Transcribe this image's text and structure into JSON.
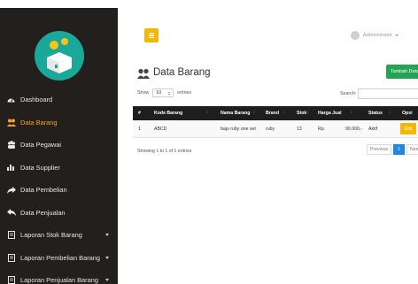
{
  "colors": {
    "sidebar_bg": "#231f1c",
    "active_menu": "#f5a623",
    "accent_yellow": "#f5b800",
    "add_button": "#23a455",
    "table_header": "#1e1e1e",
    "pagination_active": "#1e88e5",
    "logo_circle": "#1aa89a"
  },
  "sidebar": {
    "logo_icon": "box-with-coins-icon",
    "items": [
      {
        "label": "Dashboard",
        "icon": "gauge-icon",
        "active": false,
        "has_caret": false
      },
      {
        "label": "Data Barang",
        "icon": "people-icon",
        "active": true,
        "has_caret": false
      },
      {
        "label": "Data Pegawai",
        "icon": "users-icon",
        "active": false,
        "has_caret": false
      },
      {
        "label": "Data Supplier",
        "icon": "bar-chart-icon",
        "active": false,
        "has_caret": false
      },
      {
        "label": "Data Pembelian",
        "icon": "share-icon",
        "active": false,
        "has_caret": false
      },
      {
        "label": "Data Penjualan",
        "icon": "reply-icon",
        "active": false,
        "has_caret": false
      },
      {
        "label": "Laporan Stok Barang",
        "icon": "document-icon",
        "active": false,
        "has_caret": true
      },
      {
        "label": "Laporan Pembelian Barang",
        "icon": "document-icon",
        "active": false,
        "has_caret": true
      },
      {
        "label": "Laporan Penjualan Barang",
        "icon": "document-icon",
        "active": false,
        "has_caret": true
      }
    ]
  },
  "header": {
    "menu_toggle_icon": "hamburger-icon",
    "user_name": "Administrator"
  },
  "page": {
    "title": "Data Barang",
    "add_button_label": "Tambah Data"
  },
  "table_controls": {
    "show_label": "Show",
    "page_length": "10",
    "entries_label": "entries",
    "search_label": "Search:",
    "search_value": ""
  },
  "table": {
    "columns": [
      "#",
      "Kode Barang",
      "Nama Barang",
      "Brand",
      "Stok",
      "Harga Jual",
      "Status",
      "Opsi"
    ],
    "rows": [
      {
        "no": "1",
        "kode": "ABCD",
        "nama": "baju ruby one set",
        "brand": "ruby",
        "stok": "13",
        "harga_currency": "Rp.",
        "harga_value": "90.000,-",
        "status": "Aktif",
        "action": "Edit"
      }
    ]
  },
  "footer": {
    "info": "Showing 1 to 1 of 1 entries",
    "prev_label": "Previous",
    "current_page": "1",
    "next_label": "Next"
  }
}
